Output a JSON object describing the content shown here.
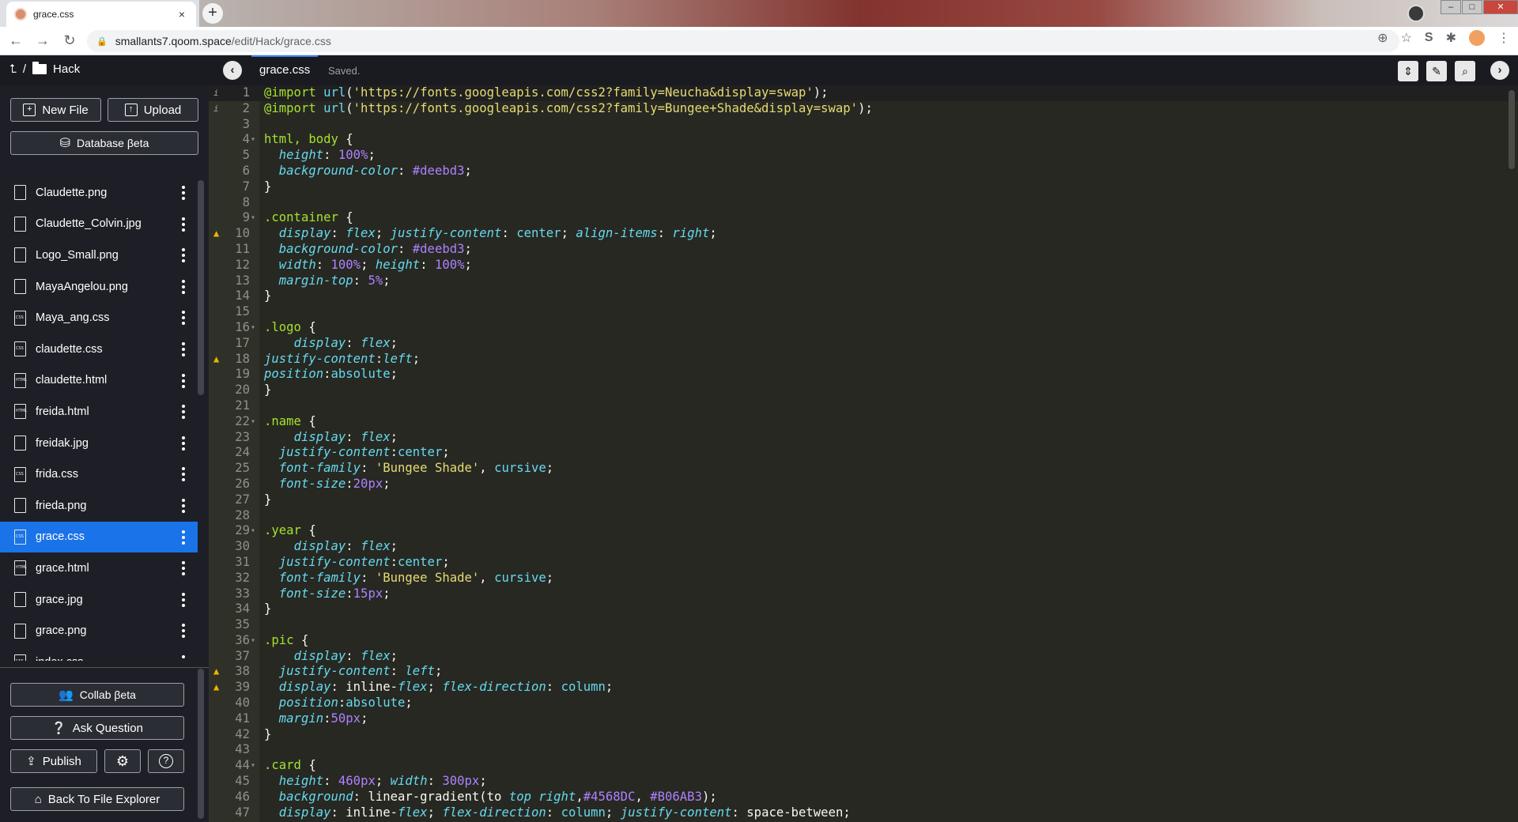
{
  "browser": {
    "tab_title": "grace.css",
    "tab_close": "×",
    "new_tab": "+",
    "url_host": "smallants7.qoom.space",
    "url_path": "/edit/Hack/grace.css"
  },
  "header": {
    "folder": "Hack",
    "file_tab": "grace.css",
    "status": "Saved."
  },
  "sidebar": {
    "new_file": "New File",
    "upload": "Upload",
    "database": "Database βeta",
    "files": [
      {
        "name": "Claudette.png",
        "type": ""
      },
      {
        "name": "Claudette_Colvin.jpg",
        "type": ""
      },
      {
        "name": "Logo_Small.png",
        "type": ""
      },
      {
        "name": "MayaAngelou.png",
        "type": ""
      },
      {
        "name": "Maya_ang.css",
        "type": "CSS"
      },
      {
        "name": "claudette.css",
        "type": "CSS"
      },
      {
        "name": "claudette.html",
        "type": "HTML"
      },
      {
        "name": "freida.html",
        "type": "HTML"
      },
      {
        "name": "freidak.jpg",
        "type": ""
      },
      {
        "name": "frida.css",
        "type": "CSS"
      },
      {
        "name": "frieda.png",
        "type": ""
      },
      {
        "name": "grace.css",
        "type": "CSS"
      },
      {
        "name": "grace.html",
        "type": "HTML"
      },
      {
        "name": "grace.jpg",
        "type": ""
      },
      {
        "name": "grace.png",
        "type": ""
      },
      {
        "name": "index.css",
        "type": "CSS"
      }
    ],
    "active_file": "grace.css",
    "collab": "Collab βeta",
    "ask": "Ask Question",
    "publish": "Publish",
    "back": "Back To File Explorer"
  },
  "editor": {
    "warning_lines": [
      10,
      18,
      38,
      39
    ],
    "info_lines": [
      1,
      2
    ],
    "fold_lines": [
      4,
      9,
      16,
      22,
      29,
      36,
      44
    ],
    "lines": [
      "@import url('https://fonts.googleapis.com/css2?family=Neucha&display=swap');",
      "@import url('https://fonts.googleapis.com/css2?family=Bungee+Shade&display=swap');",
      "",
      "html, body {",
      "  height: 100%;",
      "  background-color: #deebd3;",
      "}",
      "",
      ".container {",
      "  display: flex; justify-content: center; align-items: right;",
      "  background-color: #deebd3;",
      "  width: 100%; height: 100%;",
      "  margin-top: 5%;",
      "}",
      "",
      ".logo {",
      "    display: flex;",
      "justify-content:left;",
      "position:absolute;",
      "}",
      "",
      ".name {",
      "    display: flex;",
      "  justify-content:center;",
      "  font-family: 'Bungee Shade', cursive;",
      "  font-size:20px;",
      "}",
      "",
      ".year {",
      "    display: flex;",
      "  justify-content:center;",
      "  font-family: 'Bungee Shade', cursive;",
      "  font-size:15px;",
      "}",
      "",
      ".pic {",
      "    display: flex;",
      "  justify-content: left;",
      "  display: inline-flex; flex-direction: column;",
      "  position:absolute;",
      "  margin:50px;",
      "}",
      "",
      ".card {",
      "  height: 460px; width: 300px;",
      "  background: linear-gradient(to top right,#4568DC, #B06AB3);",
      "  display: inline-flex; flex-direction: column; justify-content: space-between;"
    ]
  },
  "colors": {
    "accent": "#1a73e8",
    "editor_bg": "#272822",
    "selector": "#a6e22e",
    "property": "#66d9ef",
    "number": "#ae81ff",
    "string": "#e6db74"
  }
}
